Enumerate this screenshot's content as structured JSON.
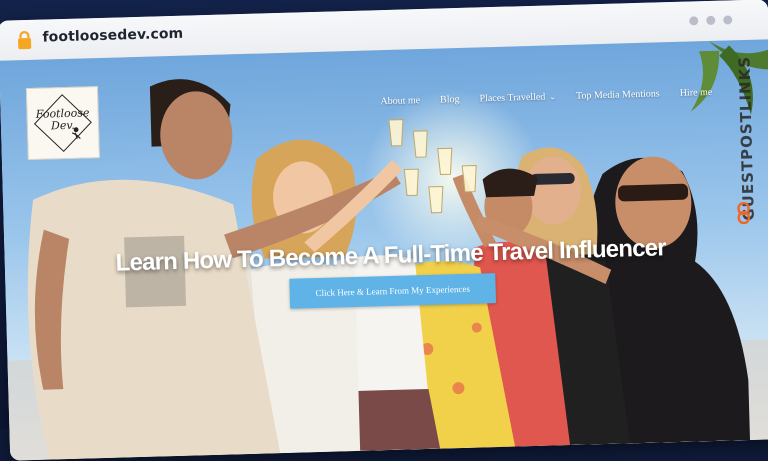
{
  "browser": {
    "url": "footloosedev.com"
  },
  "site": {
    "logo_name": "Footloose Dev.",
    "nav": [
      {
        "label": "About me",
        "has_dropdown": false
      },
      {
        "label": "Blog",
        "has_dropdown": false
      },
      {
        "label": "Places Travelled",
        "has_dropdown": true
      },
      {
        "label": "Top Media Mentions",
        "has_dropdown": false
      },
      {
        "label": "Hire me",
        "has_dropdown": false
      }
    ],
    "hero_title": "Learn How To Become A Full-Time Travel Influencer",
    "cta_label": "Click Here & Learn From My Experiences"
  },
  "watermark": {
    "text": "GUESTPOSTLINKS"
  },
  "icons": {
    "lock": "lock-icon",
    "dropdown": "chevron-down-icon",
    "window_dots": "window-dots-icon",
    "link": "link-icon"
  },
  "colors": {
    "lock": "#f5a623",
    "cta": "#5fb3e6",
    "watermark_link": "#f26522"
  }
}
